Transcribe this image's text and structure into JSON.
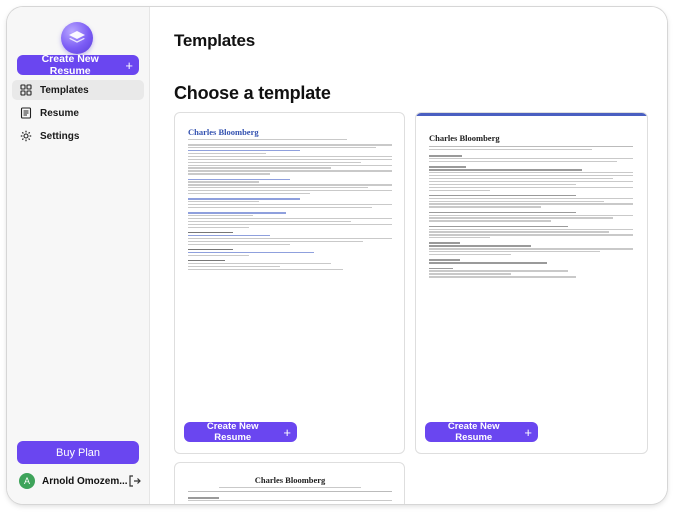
{
  "sidebar": {
    "new_resume_label": "Create New Resume",
    "nav": [
      {
        "label": "Templates",
        "icon": "templates-icon",
        "active": true
      },
      {
        "label": "Resume",
        "icon": "resume-icon",
        "active": false
      },
      {
        "label": "Settings",
        "icon": "settings-icon",
        "active": false
      }
    ],
    "buy_label": "Buy Plan",
    "user": {
      "initial": "A",
      "name": "Arnold Omozem..."
    }
  },
  "main": {
    "page_title": "Templates",
    "section_title": "Choose a template",
    "cards": [
      {
        "name": "Charles Bloomberg",
        "button": "Create New Resume"
      },
      {
        "name": "Charles Bloomberg",
        "button": "Create New Resume"
      },
      {
        "name": "Charles Bloomberg"
      }
    ]
  },
  "colors": {
    "accent": "#6a46f0",
    "sidebar_bg": "#f7f7f7",
    "active_nav": "#e9e9e9",
    "card_accent": "#4a5fc1",
    "avatar": "#3ea35a"
  }
}
